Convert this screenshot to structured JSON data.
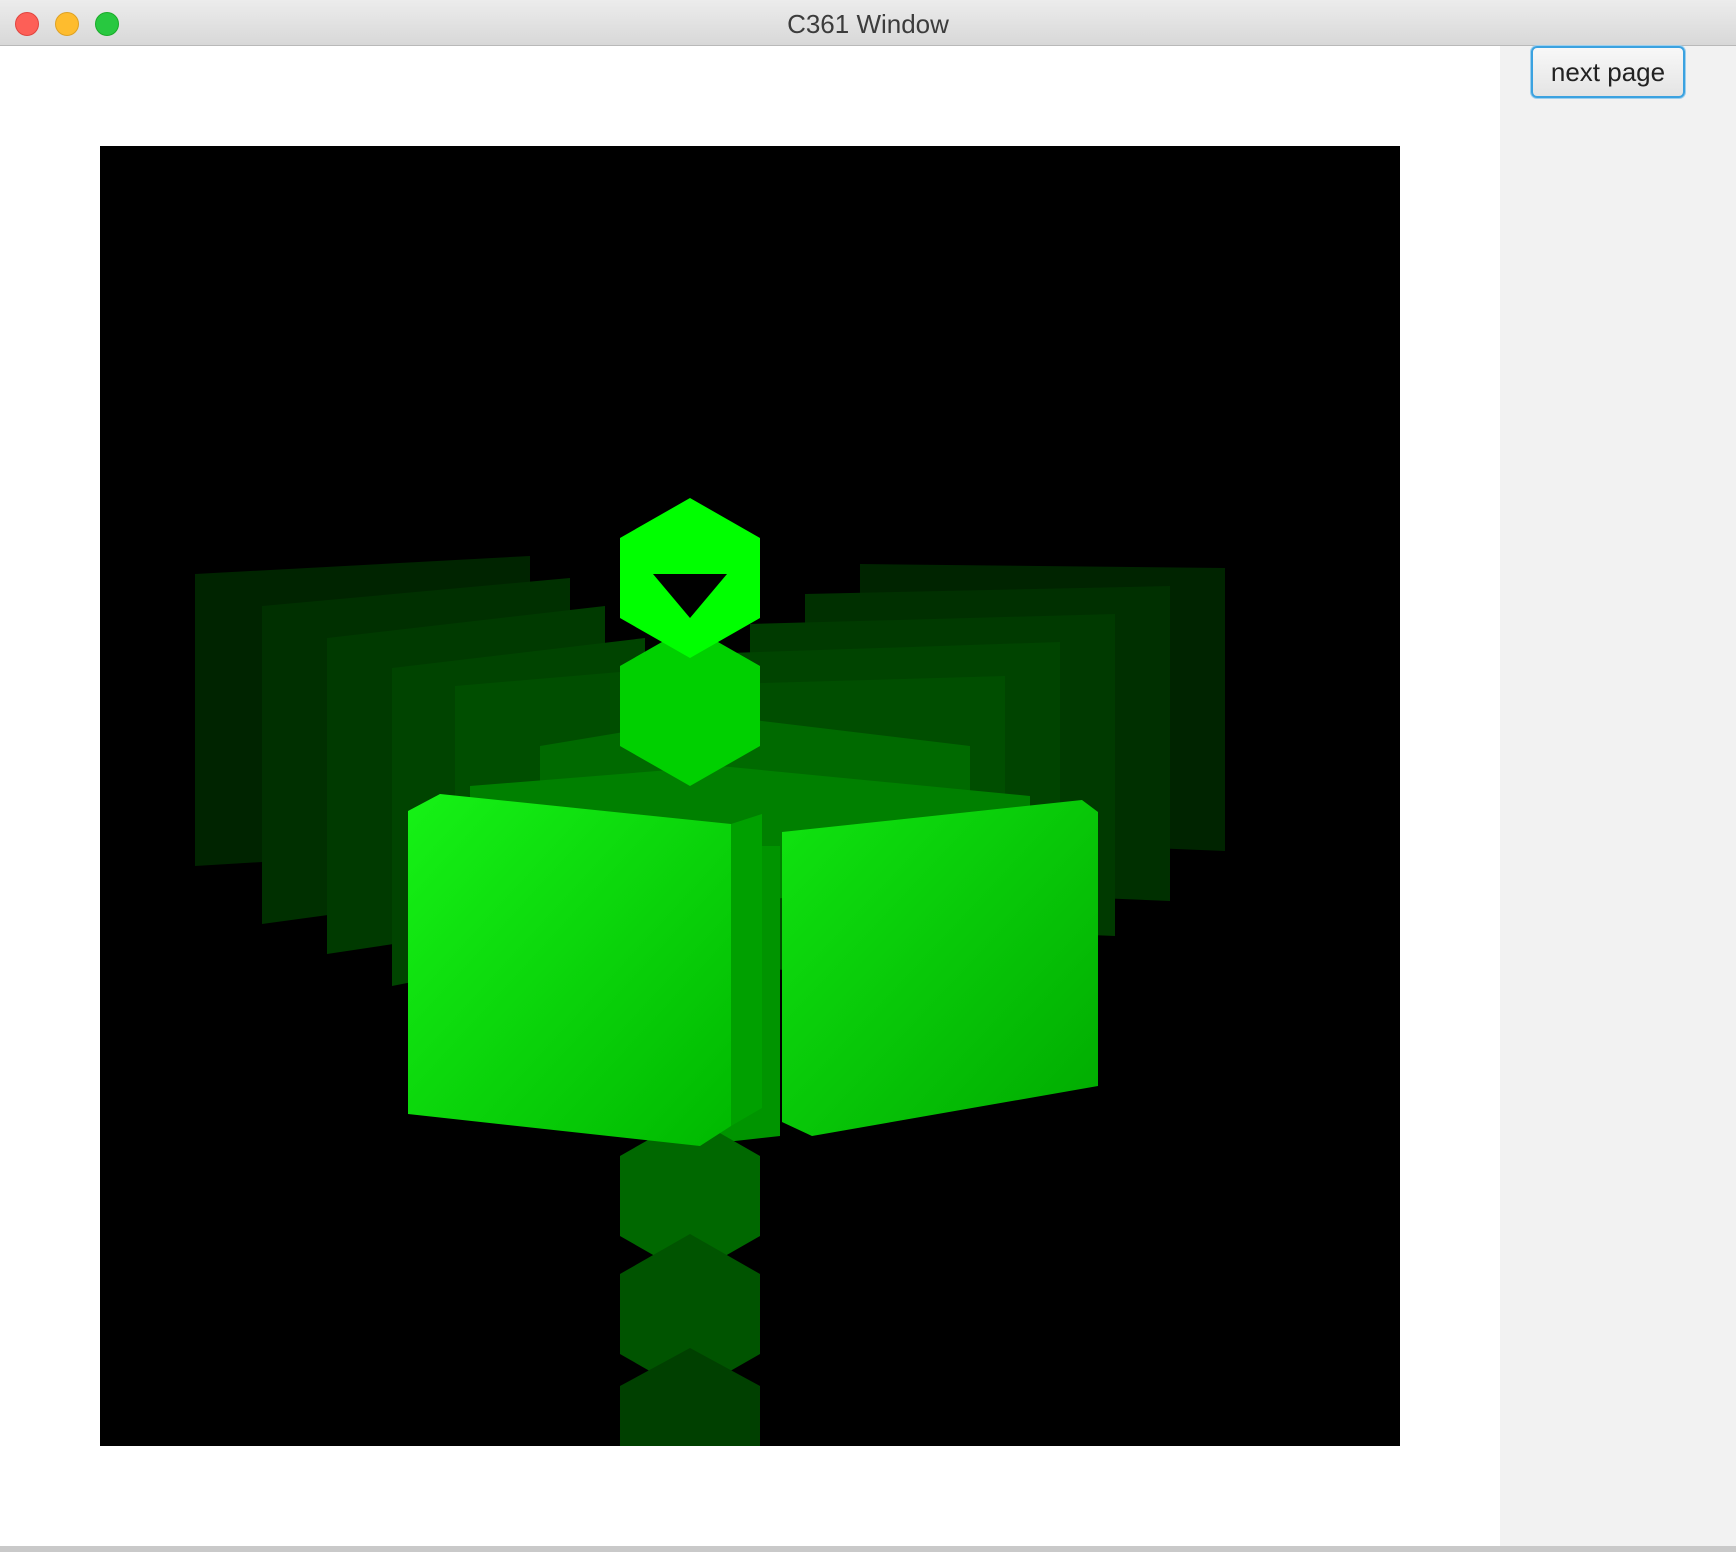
{
  "window": {
    "title": "C361 Window"
  },
  "toolbar": {
    "next_page_label": "next page"
  },
  "colors": {
    "accent": "#3ba2e0",
    "scene_background": "#000000",
    "bright_green": "#00ff00",
    "mid_green": "#00c400",
    "dark_green": "#004a00"
  },
  "icons": {
    "close": "close-icon",
    "minimize": "minimize-icon",
    "zoom": "zoom-icon"
  }
}
